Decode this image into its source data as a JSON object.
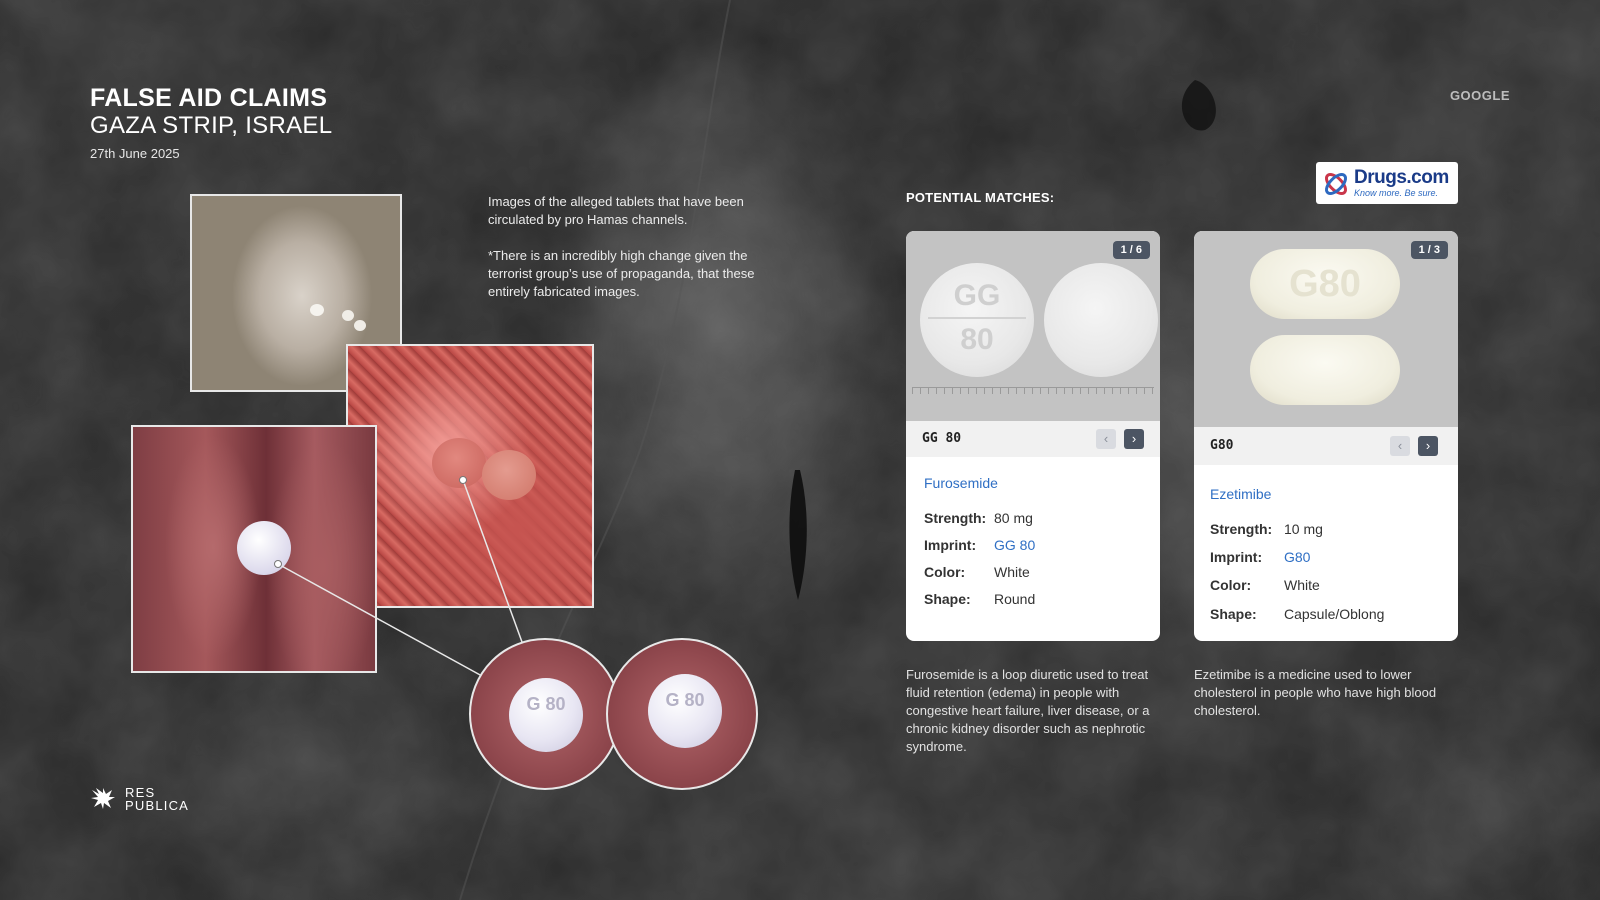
{
  "header": {
    "title_line1": "FALSE AID CLAIMS",
    "title_line2": "GAZA STRIP, ISRAEL",
    "date": "27th June 2025",
    "source": "GOOGLE"
  },
  "description": {
    "paragraph1": "Images of the alleged tablets that have been circulated by pro Hamas channels.",
    "paragraph2": "*There is an incredibly high change given the terrorist group’s use of propaganda, that these entirely fabricated images."
  },
  "evidence": {
    "zoom_imprint_1": "G 80",
    "zoom_imprint_2": "G 80"
  },
  "matches": {
    "heading": "POTENTIAL MATCHES:",
    "logo": {
      "name": "Drugs.com",
      "tagline": "Know more. Be sure."
    },
    "cards": [
      {
        "counter": "1 / 6",
        "code": "GG 80",
        "pill_imprint_top": "GG",
        "pill_imprint_bottom": "80",
        "drug": "Furosemide",
        "strength_label": "Strength:",
        "strength": "80 mg",
        "imprint_label": "Imprint:",
        "imprint": "GG 80",
        "color_label": "Color:",
        "color": "White",
        "shape_label": "Shape:",
        "shape": "Round",
        "description": "Furosemide is a loop diuretic used to treat fluid retention (edema) in people with congestive heart failure, liver disease, or a chronic kidney disorder such as nephrotic syndrome."
      },
      {
        "counter": "1 / 3",
        "code": "G80",
        "pill_imprint": "G80",
        "drug": "Ezetimibe",
        "strength_label": "Strength:",
        "strength": "10 mg",
        "imprint_label": "Imprint:",
        "imprint": "G80",
        "color_label": "Color:",
        "color": "White",
        "shape_label": "Shape:",
        "shape": "Capsule/Oblong",
        "description": "Ezetimibe is a medicine used to lower cholesterol in people who have high blood cholesterol."
      }
    ],
    "nav_prev_icon": "‹",
    "nav_next_icon": "›"
  },
  "branding": {
    "line1": "RES",
    "line2": "PUBLICA"
  },
  "colors": {
    "background": "#2a2a2a",
    "link": "#2f6fc4",
    "nav_active": "#4c5563"
  }
}
